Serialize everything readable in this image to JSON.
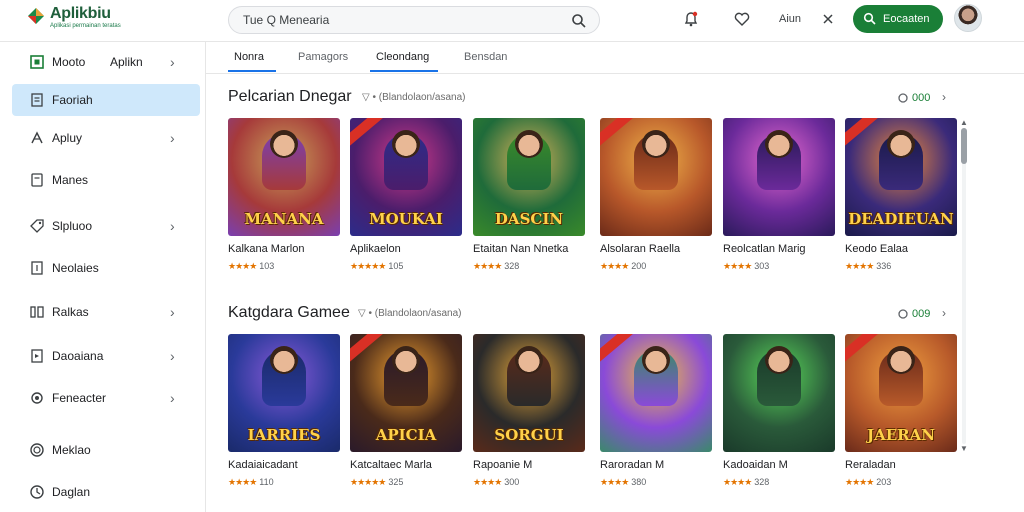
{
  "app": {
    "title": "Aplikbiu",
    "subtitle": "Aplikasi permainan teratas"
  },
  "search": {
    "query": "Tue Q Menearia"
  },
  "topbar": {
    "text_item": "Aiun",
    "cta_label": "Eocaaten",
    "colors": {
      "cta": "#1a7f37",
      "brand": "#1f5f3b"
    }
  },
  "sidebar": {
    "items": [
      {
        "label": "Mooto",
        "extra": "Aplikn",
        "chevron": "›",
        "icon": "home-icon",
        "active": false
      },
      {
        "label": "Faoriah",
        "chevron": "",
        "icon": "document-icon",
        "active": true
      },
      {
        "label": "Apluy",
        "chevron": "›",
        "icon": "apps-icon",
        "active": false
      },
      {
        "label": "Manes",
        "chevron": "",
        "icon": "bookmark-icon",
        "active": false
      },
      {
        "label": "Slpluoo",
        "chevron": "›",
        "icon": "tag-icon",
        "active": false
      },
      {
        "label": "Neolaies",
        "chevron": "",
        "icon": "square-icon",
        "active": false
      },
      {
        "label": "Ralkas",
        "chevron": "›",
        "icon": "grid-icon",
        "active": false
      },
      {
        "label": "Daoaiana",
        "chevron": "›",
        "icon": "flag-icon",
        "active": false
      },
      {
        "label": "Feneacter",
        "chevron": "›",
        "icon": "gear-icon",
        "active": false
      },
      {
        "label": "Meklao",
        "chevron": "",
        "icon": "circle-icon",
        "active": false
      },
      {
        "label": "Daglan",
        "chevron": "",
        "icon": "clock-icon",
        "active": false
      }
    ]
  },
  "tabs": [
    {
      "label": "Nonra",
      "active": true
    },
    {
      "label": "Pamagors",
      "active": false
    },
    {
      "label": "Cleondang",
      "active": true
    },
    {
      "label": "Bensdan",
      "active": false
    }
  ],
  "sections": [
    {
      "title": "Pelcarian Dnegar",
      "subtitle": "▽ • (Blandolaon/asana)",
      "more_label": "000",
      "arrow": "›",
      "apps": [
        {
          "name": "Kalkana Marlon",
          "stars": "★★★★",
          "rating": "103",
          "banner": "MANANA",
          "palette": [
            "#a63a3a",
            "#c9a25a",
            "#7a3fb0"
          ]
        },
        {
          "name": "Aplikaelon",
          "stars": "★★★★★",
          "rating": "105",
          "banner": "MOUKAI",
          "palette": [
            "#4b1d6b",
            "#d13a8a",
            "#2c2c8a"
          ]
        },
        {
          "name": "Etaitan Nan Nnetka",
          "stars": "★★★★",
          "rating": "328",
          "banner": "DASCIN",
          "palette": [
            "#1f6b3a",
            "#d8b35a",
            "#3a8a2a"
          ]
        },
        {
          "name": "Alsolaran Raella",
          "stars": "★★★★",
          "rating": "200",
          "banner": "",
          "palette": [
            "#b8582a",
            "#f0b44a",
            "#6b2a18"
          ]
        },
        {
          "name": "Reolcatlan Marig",
          "stars": "★★★★",
          "rating": "303",
          "banner": "",
          "palette": [
            "#6b2a9a",
            "#e86ad0",
            "#2a1a5a"
          ]
        },
        {
          "name": "Keodo Ealaa",
          "stars": "★★★★",
          "rating": "336",
          "banner": "DEADIEUAN",
          "palette": [
            "#3a2a7a",
            "#f08a3a",
            "#1a1a4a"
          ]
        }
      ]
    },
    {
      "title": "Katgdara Gamee",
      "subtitle": "▽ • (Blandolaon/asana)",
      "more_label": "009",
      "arrow": "›",
      "apps": [
        {
          "name": "Kadaiaicadant",
          "stars": "★★★★",
          "rating": "110",
          "banner": "IARRIES",
          "palette": [
            "#2a3a9a",
            "#8a5ad8",
            "#1a2a6a"
          ]
        },
        {
          "name": "Katcaltaec Marla",
          "stars": "★★★★★",
          "rating": "325",
          "banner": "APICIA",
          "palette": [
            "#4a2a1a",
            "#f0a030",
            "#2a1a2a"
          ]
        },
        {
          "name": "Rapoanie M",
          "stars": "★★★★",
          "rating": "300",
          "banner": "SORGUI",
          "palette": [
            "#2a2a2a",
            "#e8a83a",
            "#5a2a1a"
          ]
        },
        {
          "name": "Raroradan M",
          "stars": "★★★★",
          "rating": "380",
          "banner": "",
          "palette": [
            "#8a4ad8",
            "#f0c040",
            "#3a8a6a"
          ]
        },
        {
          "name": "Kadoaidan M",
          "stars": "★★★★",
          "rating": "328",
          "banner": "",
          "palette": [
            "#2a5a3a",
            "#5ad85a",
            "#1a3a2a"
          ]
        },
        {
          "name": "Reraladan",
          "stars": "★★★★",
          "rating": "203",
          "banner": "JAERAN",
          "palette": [
            "#b85a2a",
            "#f0a040",
            "#6a2a1a"
          ]
        }
      ]
    }
  ]
}
